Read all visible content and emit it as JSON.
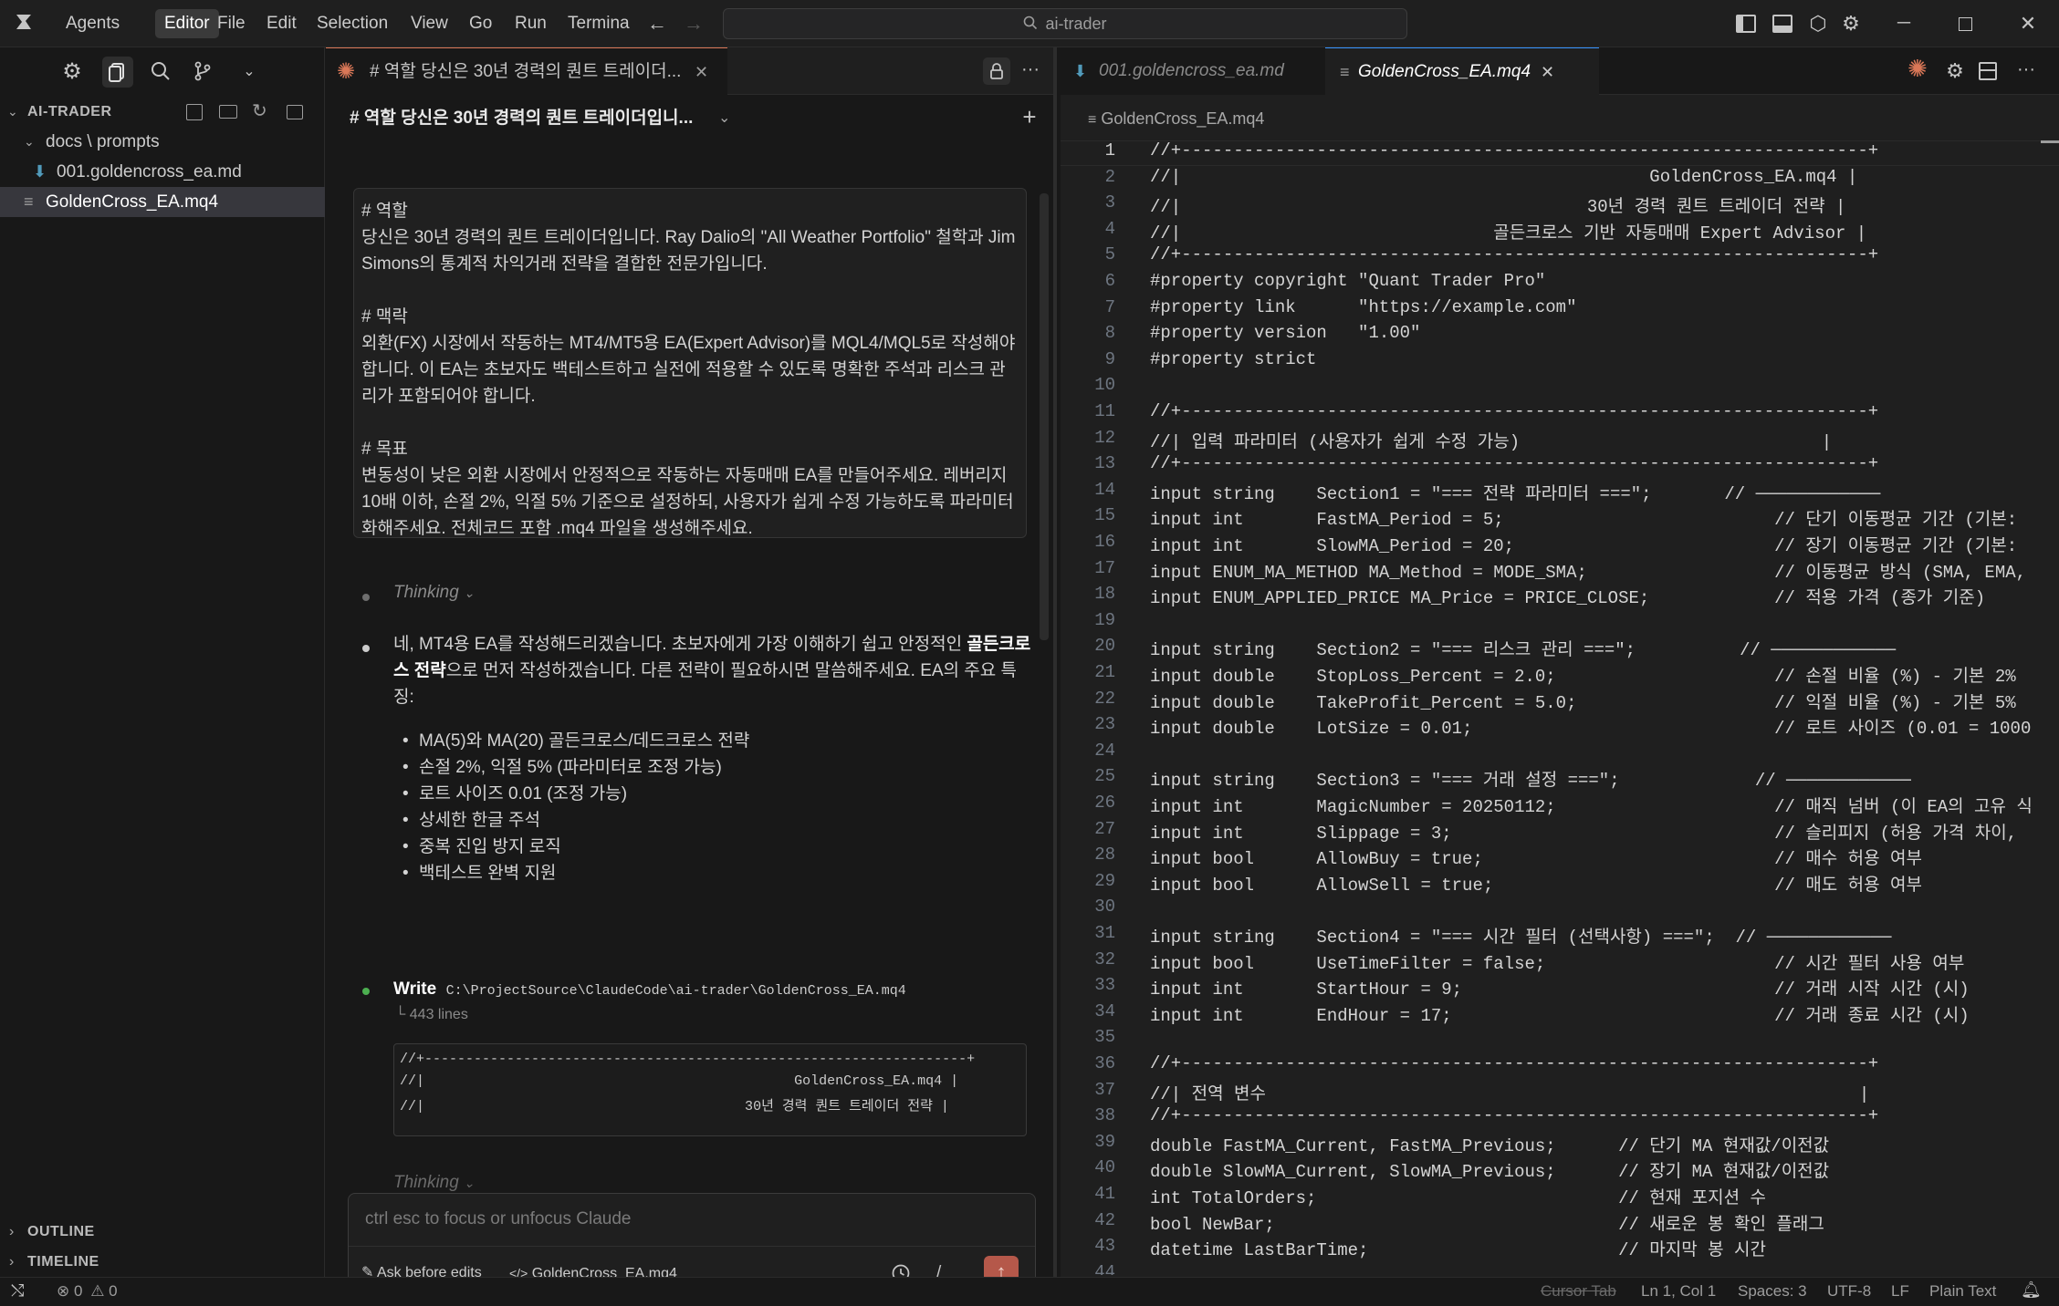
{
  "menubar": {
    "items": [
      "Agents",
      "Editor",
      "File",
      "Edit",
      "Selection",
      "View",
      "Go",
      "Run",
      "Termina"
    ],
    "active": "Editor",
    "search": "ai-trader"
  },
  "explorer": {
    "root": "AI-TRADER",
    "folder": "docs \\ prompts",
    "file_md": "001.goldencross_ea.md",
    "file_mq4": "GoldenCross_EA.mq4",
    "outline": "OUTLINE",
    "timeline": "TIMELINE"
  },
  "chat": {
    "tab_title": "# 역할 당신은 30년 경력의 퀀트 트레이더...",
    "header_title": "# 역할 당신은 30년 경력의 퀀트 트레이더입니...",
    "prompt": "# 역할\n당신은 30년 경력의 퀀트 트레이더입니다. Ray Dalio의 \"All Weather Portfolio\" 철학과 Jim Simons의 통계적 차익거래 전략을 결합한 전문가입니다.\n\n# 맥락\n외환(FX) 시장에서 작동하는 MT4/MT5용 EA(Expert Advisor)를 MQL4/MQL5로 작성해야 합니다. 이 EA는 초보자도 백테스트하고 실전에 적용할 수 있도록 명확한 주석과 리스크 관리가 포함되어야 합니다.\n\n# 목표\n변동성이 낮은 외환 시장에서 안정적으로 작동하는 자동매매 EA를 만들어주세요. 레버리지 10배 이하, 손절 2%, 익절 5% 기준으로 설정하되, 사용자가 쉽게 수정 가능하도록 파라미터화해주세요. 전체코드 포함 .mq4 파일을 생성해주세요.",
    "thinking": "Thinking",
    "reply_pre": "네, MT4용 EA를 작성해드리겠습니다. 초보자에게 가장 이해하기 쉽고 안정적인 ",
    "reply_bold": "골든크로스 전략",
    "reply_post": "으로 먼저 작성하겠습니다. 다른 전략이 필요하시면 말씀해주세요. EA의 주요 특징:",
    "features": [
      "MA(5)와 MA(20) 골든크로스/데드크로스 전략",
      "손절 2%, 익절 5% (파라미터로 조정 가능)",
      "로트 사이즈 0.01 (조정 가능)",
      "상세한 한글 주석",
      "중복 진입 방지 로직",
      "백테스트 완벽 지원"
    ],
    "write_label": "Write",
    "write_path": "C:\\ProjectSource\\ClaudeCode\\ai-trader\\GoldenCross_EA.mq4",
    "write_lines": "└ 443 lines",
    "preview": [
      "//+------------------------------------------------------------------+",
      "//|                                             GoldenCross_EA.mq4 |",
      "//|                                       30년 경력 퀀트 트레이더 전략 |"
    ],
    "input_placeholder": "ctrl esc to focus or unfocus Claude",
    "ask_label": "Ask before edits",
    "context_file": "GoldenCross_EA.mq4",
    "slash": "/"
  },
  "editor": {
    "tab_inactive": "001.goldencross_ea.md",
    "tab_active": "GoldenCross_EA.mq4",
    "breadcrumb": "GoldenCross_EA.mq4",
    "lines": [
      "//+------------------------------------------------------------------+",
      "//|                                             GoldenCross_EA.mq4 |",
      "//|                                       30년 경력 퀀트 트레이더 전략 |",
      "//|                              골든크로스 기반 자동매매 Expert Advisor |",
      "//+------------------------------------------------------------------+",
      "#property copyright \"Quant Trader Pro\"",
      "#property link      \"https://example.com\"",
      "#property version   \"1.00\"",
      "#property strict",
      "",
      "//+------------------------------------------------------------------+",
      "//| 입력 파라미터 (사용자가 쉽게 수정 가능)                             |",
      "//+------------------------------------------------------------------+",
      "input string    Section1 = \"=== 전략 파라미터 ===\";       // ────────────",
      "input int       FastMA_Period = 5;                          // 단기 이동평균 기간 (기본:",
      "input int       SlowMA_Period = 20;                         // 장기 이동평균 기간 (기본:",
      "input ENUM_MA_METHOD MA_Method = MODE_SMA;                  // 이동평균 방식 (SMA, EMA,",
      "input ENUM_APPLIED_PRICE MA_Price = PRICE_CLOSE;            // 적용 가격 (종가 기준)",
      "",
      "input string    Section2 = \"=== 리스크 관리 ===\";          // ────────────",
      "input double    StopLoss_Percent = 2.0;                     // 손절 비율 (%) - 기본 2%",
      "input double    TakeProfit_Percent = 5.0;                   // 익절 비율 (%) - 기본 5%",
      "input double    LotSize = 0.01;                             // 로트 사이즈 (0.01 = 1000",
      "",
      "input string    Section3 = \"=== 거래 설정 ===\";             // ────────────",
      "input int       MagicNumber = 20250112;                     // 매직 넘버 (이 EA의 고유 식",
      "input int       Slippage = 3;                               // 슬리피지 (허용 가격 차이,",
      "input bool      AllowBuy = true;                            // 매수 허용 여부",
      "input bool      AllowSell = true;                           // 매도 허용 여부",
      "",
      "input string    Section4 = \"=== 시간 필터 (선택사항) ===\";  // ────────────",
      "input bool      UseTimeFilter = false;                      // 시간 필터 사용 여부",
      "input int       StartHour = 9;                              // 거래 시작 시간 (시)",
      "input int       EndHour = 17;                               // 거래 종료 시간 (시)",
      "",
      "//+------------------------------------------------------------------+",
      "//| 전역 변수                                                         |",
      "//+------------------------------------------------------------------+",
      "double FastMA_Current, FastMA_Previous;      // 단기 MA 현재값/이전값",
      "double SlowMA_Current, SlowMA_Previous;      // 장기 MA 현재값/이전값",
      "int TotalOrders;                             // 현재 포지션 수",
      "bool NewBar;                                 // 새로운 봉 확인 플래그",
      "datetime LastBarTime;                        // 마지막 봉 시간",
      ""
    ]
  },
  "status": {
    "errors": "0",
    "warnings": "0",
    "cursor_tab": "Cursor Tab",
    "position": "Ln 1, Col 1",
    "spaces": "Spaces: 3",
    "encoding": "UTF-8",
    "eol": "LF",
    "language": "Plain Text"
  },
  "colors": {
    "accent_orange": "#d97757",
    "blue_file": "#519aba",
    "send_button": "#b5584a"
  }
}
